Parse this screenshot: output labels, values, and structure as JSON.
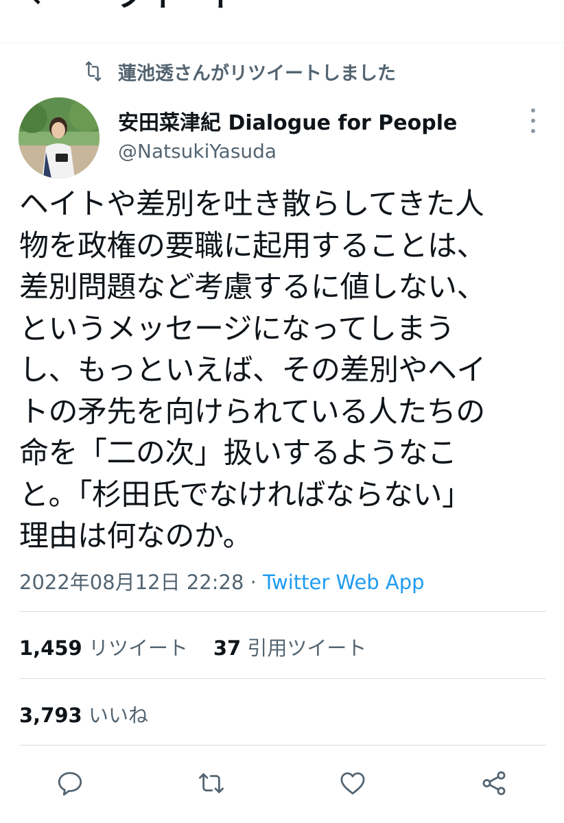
{
  "header": {
    "back_glyph": "←",
    "title": "ツイート"
  },
  "retweet_banner": {
    "icon": "retweet-icon",
    "text": "蓮池透さんがリツイートしました"
  },
  "author": {
    "display_name": "安田菜津紀 Dialogue for People",
    "handle": "@NatsukiYasuda",
    "avatar": "avatar-photo"
  },
  "tweet": {
    "lines": [
      "ヘイトや差別を吐き散らしてきた人",
      "物を政権の要職に起用することは、",
      "差別問題など考慮するに値しない、",
      "というメッセージになってしまう",
      "し、もっといえば、その差別やヘイ",
      "トの矛先を向けられている人たちの",
      "命を「二の次」扱いするようなこ",
      "と。「杉田氏でなければならない」",
      "理由は何なのか。"
    ],
    "timestamp": "2022年08月12日 22:28",
    "separator": " · ",
    "source": "Twitter Web App"
  },
  "stats": {
    "retweets_count": "1,459",
    "retweets_label": "リツイート",
    "quotes_count": "37",
    "quotes_label": "引用ツイート",
    "likes_count": "3,793",
    "likes_label": "いいね"
  },
  "actions": {
    "reply": "reply-icon",
    "retweet": "retweet-icon",
    "like": "heart-icon",
    "share": "share-icon"
  },
  "colors": {
    "link_blue": "#1d9bf0",
    "secondary_text": "#536471",
    "primary_text": "#0f1419",
    "divider": "#d9dee2"
  }
}
